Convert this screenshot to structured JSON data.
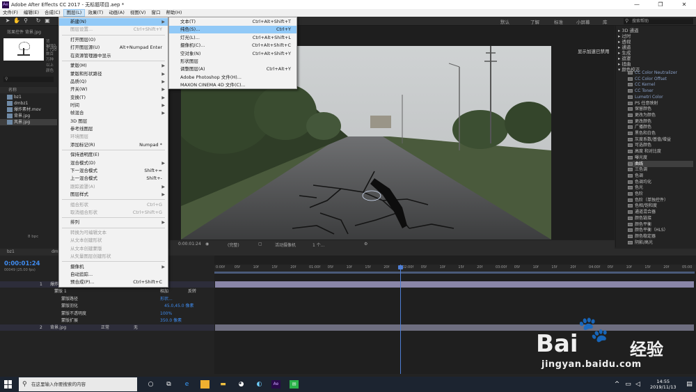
{
  "window": {
    "title": "Adobe After Effects CC 2017 - 无标题项目.aep *",
    "app_icon": "Ae",
    "controls": [
      "—",
      "❐",
      "✕"
    ]
  },
  "menubar": [
    "文件(F)",
    "编辑(E)",
    "合成(C)",
    "图层(L)",
    "效果(T)",
    "动画(A)",
    "视图(V)",
    "窗口",
    "帮助(H)"
  ],
  "workspace": {
    "tabs": [
      "默认",
      "了解",
      "标准",
      "小屏幕",
      "库"
    ],
    "search_placeholder": "搜索帮助"
  },
  "project_panel": {
    "tab": "效果控件 背景.jpg",
    "info_lines": [
      "背景.jpg",
      "1280 x 720",
      "数百万种以上颜色"
    ],
    "columns": "名称",
    "items": [
      {
        "name": "bz1",
        "selected": false
      },
      {
        "name": "dmbz1",
        "selected": false
      },
      {
        "name": "爆炸素材.mov",
        "selected": false
      },
      {
        "name": "背景.jpg",
        "selected": false
      },
      {
        "name": "风景.jpg",
        "selected": true
      }
    ],
    "bpc": "8 bpc"
  },
  "viewer": {
    "hud": "显示加速已禁用",
    "zoom": "(完整)",
    "timecode": "0:00:01:24",
    "camera": "活动摄像机",
    "views": "1 个..."
  },
  "layer_menu": [
    {
      "label": "新建(N)",
      "shortcut": "",
      "submenu": true,
      "disabled": false,
      "highlight": true
    },
    {
      "label": "图层设置...",
      "shortcut": "Ctrl+Shift+Y",
      "submenu": false,
      "disabled": true,
      "highlight": false
    },
    {
      "sep": true
    },
    {
      "label": "打开图层(O)",
      "shortcut": "",
      "submenu": false,
      "disabled": false,
      "highlight": false
    },
    {
      "label": "打开图层源(U)",
      "shortcut": "Alt+Numpad Enter",
      "submenu": false,
      "disabled": false,
      "highlight": false
    },
    {
      "label": "在资源管理器中显示",
      "shortcut": "",
      "submenu": false,
      "disabled": false,
      "highlight": false
    },
    {
      "sep": true
    },
    {
      "label": "蒙版(M)",
      "shortcut": "",
      "submenu": true,
      "disabled": false,
      "highlight": false
    },
    {
      "label": "蒙版和形状路径",
      "shortcut": "",
      "submenu": true,
      "disabled": false,
      "highlight": false
    },
    {
      "label": "品质(Q)",
      "shortcut": "",
      "submenu": true,
      "disabled": false,
      "highlight": false
    },
    {
      "label": "开关(W)",
      "shortcut": "",
      "submenu": true,
      "disabled": false,
      "highlight": false
    },
    {
      "label": "变换(T)",
      "shortcut": "",
      "submenu": true,
      "disabled": false,
      "highlight": false
    },
    {
      "label": "时间",
      "shortcut": "",
      "submenu": true,
      "disabled": false,
      "highlight": false
    },
    {
      "label": "帧混合",
      "shortcut": "",
      "submenu": true,
      "disabled": false,
      "highlight": false
    },
    {
      "label": "3D 图层",
      "shortcut": "",
      "submenu": false,
      "disabled": false,
      "highlight": false
    },
    {
      "label": "参考线图层",
      "shortcut": "",
      "submenu": false,
      "disabled": false,
      "highlight": false
    },
    {
      "label": "环境图层",
      "shortcut": "",
      "submenu": false,
      "disabled": true,
      "highlight": false
    },
    {
      "label": "添加标记(R)",
      "shortcut": "Numpad *",
      "submenu": false,
      "disabled": false,
      "highlight": false
    },
    {
      "sep": true
    },
    {
      "label": "保持透明度(E)",
      "shortcut": "",
      "submenu": false,
      "disabled": false,
      "highlight": false
    },
    {
      "label": "混合模式(D)",
      "shortcut": "",
      "submenu": true,
      "disabled": false,
      "highlight": false
    },
    {
      "label": "下一混合模式",
      "shortcut": "Shift+=",
      "submenu": false,
      "disabled": false,
      "highlight": false
    },
    {
      "label": "上一混合模式",
      "shortcut": "Shift+-",
      "submenu": false,
      "disabled": false,
      "highlight": false
    },
    {
      "label": "跟踪遮罩(A)",
      "shortcut": "",
      "submenu": true,
      "disabled": true,
      "highlight": false
    },
    {
      "label": "图层样式",
      "shortcut": "",
      "submenu": true,
      "disabled": false,
      "highlight": false
    },
    {
      "sep": true
    },
    {
      "label": "组合形状",
      "shortcut": "Ctrl+G",
      "submenu": false,
      "disabled": true,
      "highlight": false
    },
    {
      "label": "取消组合形状",
      "shortcut": "Ctrl+Shift+G",
      "submenu": false,
      "disabled": true,
      "highlight": false
    },
    {
      "sep": true
    },
    {
      "label": "排列",
      "shortcut": "",
      "submenu": true,
      "disabled": false,
      "highlight": false
    },
    {
      "sep": true
    },
    {
      "label": "转换为可编辑文本",
      "shortcut": "",
      "submenu": false,
      "disabled": true,
      "highlight": false
    },
    {
      "label": "从文本创建形状",
      "shortcut": "",
      "submenu": false,
      "disabled": true,
      "highlight": false
    },
    {
      "label": "从文本创建蒙版",
      "shortcut": "",
      "submenu": false,
      "disabled": true,
      "highlight": false
    },
    {
      "label": "从矢量图层创建形状",
      "shortcut": "",
      "submenu": false,
      "disabled": true,
      "highlight": false
    },
    {
      "sep": true
    },
    {
      "label": "摄像机",
      "shortcut": "",
      "submenu": true,
      "disabled": false,
      "highlight": false
    },
    {
      "label": "自动追踪...",
      "shortcut": "",
      "submenu": false,
      "disabled": false,
      "highlight": false
    },
    {
      "label": "预合成(P)...",
      "shortcut": "Ctrl+Shift+C",
      "submenu": false,
      "disabled": false,
      "highlight": false
    }
  ],
  "new_menu": [
    {
      "label": "文本(T)",
      "shortcut": "Ctrl+Alt+Shift+T",
      "highlight": false
    },
    {
      "label": "纯色(S)...",
      "shortcut": "Ctrl+Y",
      "highlight": true
    },
    {
      "label": "灯光(L)...",
      "shortcut": "Ctrl+Alt+Shift+L",
      "highlight": false
    },
    {
      "label": "摄像机(C)...",
      "shortcut": "Ctrl+Alt+Shift+C",
      "highlight": false
    },
    {
      "label": "空对象(N)",
      "shortcut": "Ctrl+Alt+Shift+Y",
      "highlight": false
    },
    {
      "label": "形状图层",
      "shortcut": "",
      "highlight": false
    },
    {
      "label": "调整图层(A)",
      "shortcut": "Ctrl+Alt+Y",
      "highlight": false
    },
    {
      "label": "Adobe Photoshop 文件(H)...",
      "shortcut": "",
      "highlight": false
    },
    {
      "label": "MAXON CINEMA 4D 文件(C)...",
      "shortcut": "",
      "highlight": false
    }
  ],
  "effects_panel": {
    "categories": [
      "3D 通道",
      "过时",
      "透视",
      "通道",
      "生成",
      "遮罩",
      "扭曲",
      "颜色校正"
    ],
    "items": [
      {
        "name": "CC Color Neutralizer",
        "highlight": false,
        "dim": true
      },
      {
        "name": "CC Color Offset",
        "highlight": false,
        "dim": true
      },
      {
        "name": "CC Kernel",
        "highlight": false,
        "dim": true
      },
      {
        "name": "CC Toner",
        "highlight": false,
        "dim": true
      },
      {
        "name": "Lumetri Color",
        "highlight": false,
        "dim": true
      },
      {
        "name": "PS 任意映射",
        "highlight": false,
        "dim": false
      },
      {
        "name": "保留颜色",
        "highlight": false,
        "dim": false
      },
      {
        "name": "更改为颜色",
        "highlight": false,
        "dim": false
      },
      {
        "name": "更改颜色",
        "highlight": false,
        "dim": false
      },
      {
        "name": "广播颜色",
        "highlight": false,
        "dim": false
      },
      {
        "name": "黑色和白色",
        "highlight": false,
        "dim": false
      },
      {
        "name": "灰度系数/基值/增益",
        "highlight": false,
        "dim": false
      },
      {
        "name": "可选颜色",
        "highlight": false,
        "dim": false
      },
      {
        "name": "高度 和对比度",
        "highlight": false,
        "dim": false
      },
      {
        "name": "曝光度",
        "highlight": false,
        "dim": false
      },
      {
        "name": "曲线",
        "highlight": true,
        "dim": false
      },
      {
        "name": "三色调",
        "highlight": false,
        "dim": false
      },
      {
        "name": "色调",
        "highlight": false,
        "dim": false
      },
      {
        "name": "色调均化",
        "highlight": false,
        "dim": false
      },
      {
        "name": "色光",
        "highlight": false,
        "dim": false
      },
      {
        "name": "色阶",
        "highlight": false,
        "dim": false
      },
      {
        "name": "色阶（单独控件）",
        "highlight": false,
        "dim": false
      },
      {
        "name": "色相/饱和度",
        "highlight": false,
        "dim": false
      },
      {
        "name": "通道混合器",
        "highlight": false,
        "dim": false
      },
      {
        "name": "颜色链接",
        "highlight": false,
        "dim": false
      },
      {
        "name": "颜色平衡",
        "highlight": false,
        "dim": false
      },
      {
        "name": "颜色平衡（HLS）",
        "highlight": false,
        "dim": false
      },
      {
        "name": "颜色稳定器",
        "highlight": false,
        "dim": false
      },
      {
        "name": "阴影/高光",
        "highlight": false,
        "dim": false
      }
    ]
  },
  "timeline": {
    "tabs": [
      "bz1",
      "dmbz1"
    ],
    "timecode": "0:00:01:24",
    "fps_info": "00049 (25.00 fps)",
    "ruler_ticks": [
      "0:00f",
      "05f",
      "10f",
      "15f",
      "20f",
      "01:00f",
      "05f",
      "10f",
      "15f",
      "20f",
      "02:00f",
      "05f",
      "10f",
      "15f",
      "20f",
      "03:00f",
      "05f",
      "10f",
      "15f",
      "20f",
      "04:00f",
      "05f",
      "10f",
      "15f",
      "20f",
      "05:00"
    ],
    "layers": [
      {
        "index": "1",
        "name": "爆炸素材.mov",
        "mode": "正常"
      },
      {
        "index": "2",
        "name": "背景.jpg",
        "mode": "正常",
        "trkmat": "无"
      }
    ],
    "mask": {
      "name": "蒙版 1",
      "mode": "相加",
      "invert": "反转"
    },
    "props": [
      {
        "name": "蒙版路径",
        "value": "形状..."
      },
      {
        "name": "蒙版羽化",
        "value": "45.0,45.0 像素"
      },
      {
        "name": "蒙版不透明度",
        "value": "100%"
      },
      {
        "name": "蒙版扩展",
        "value": "350.0 像素"
      }
    ]
  },
  "taskbar": {
    "search_placeholder": "在这里输入你要搜索的内容",
    "time": "14:55",
    "date": "2019/11/13"
  },
  "watermark": {
    "brand": "Bai",
    "brand_cn": "经验",
    "url": "jingyan.baidu.com"
  }
}
